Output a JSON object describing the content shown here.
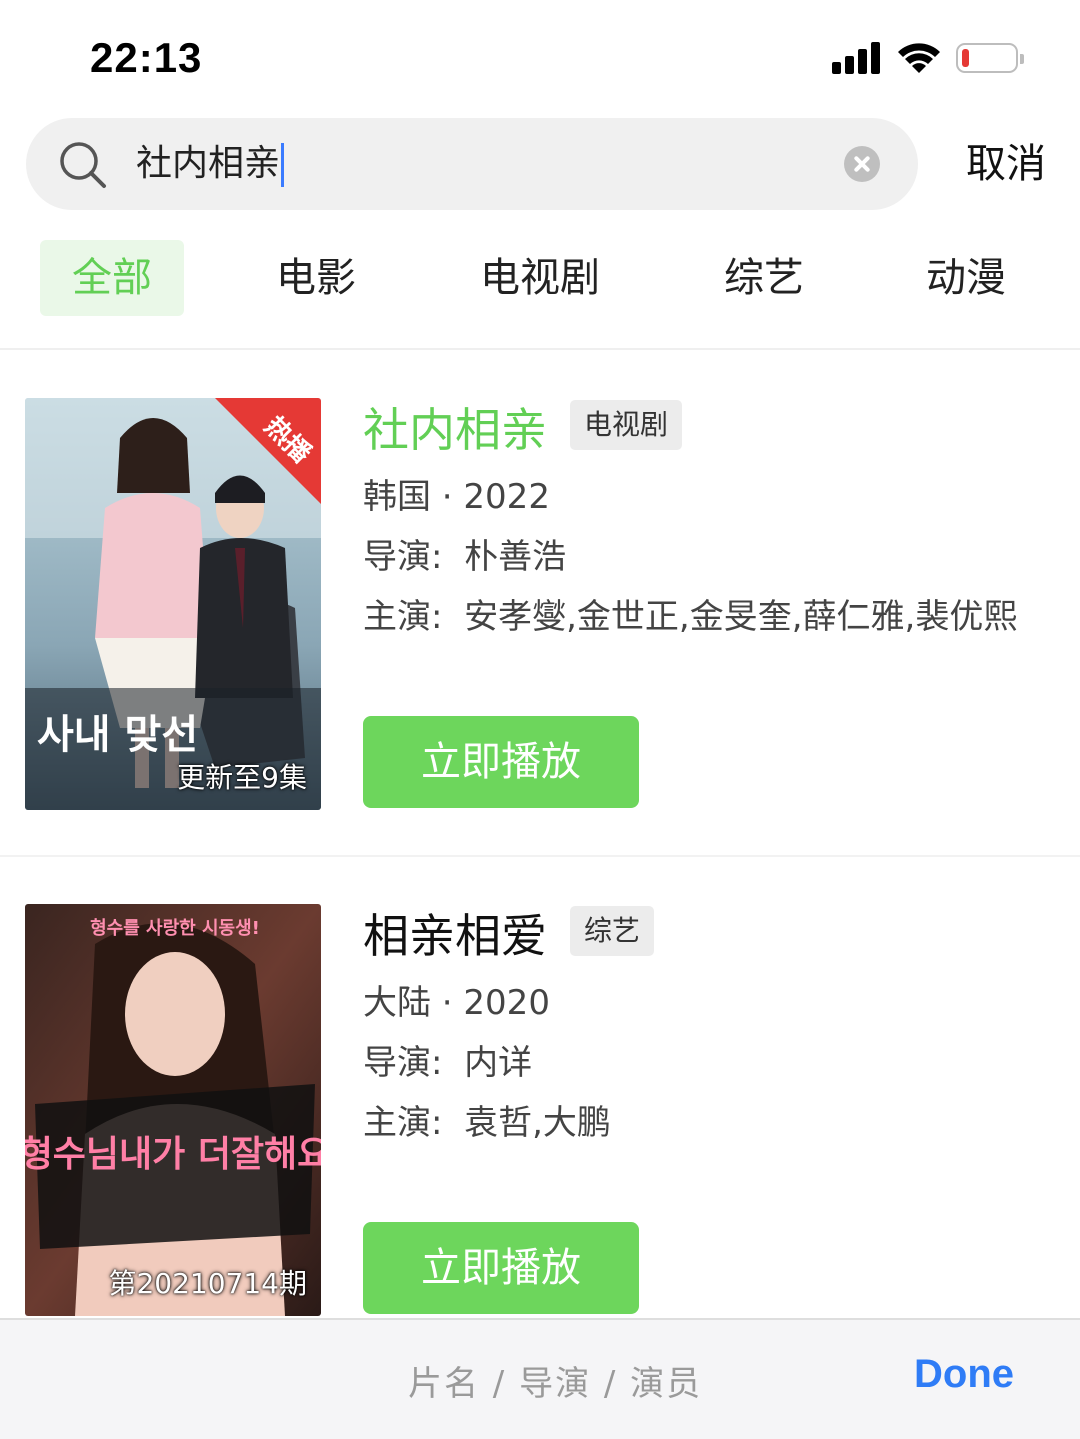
{
  "status_bar": {
    "time": "22:13"
  },
  "search": {
    "query": "社内相亲",
    "cancel_label": "取消"
  },
  "tabs": [
    {
      "label": "全部",
      "active": true
    },
    {
      "label": "电影",
      "active": false
    },
    {
      "label": "电视剧",
      "active": false
    },
    {
      "label": "综艺",
      "active": false
    },
    {
      "label": "动漫",
      "active": false
    }
  ],
  "results": [
    {
      "title": "社内相亲",
      "tag": "电视剧",
      "region_year": "韩国 · 2022",
      "director_label": "导演:",
      "director": "朴善浩",
      "cast_label": "主演:",
      "cast": "安孝燮,金世正,金旻奎,薛仁雅,裴优熙",
      "play_label": "立即播放",
      "poster_badge": "热播",
      "poster_caption": "更新至9集",
      "poster_title_text": "사내 맞선"
    },
    {
      "title": "相亲相爱",
      "tag": "综艺",
      "region_year": "大陆 · 2020",
      "director_label": "导演:",
      "director": "内详",
      "cast_label": "主演:",
      "cast": "袁哲,大鹏",
      "play_label": "立即播放",
      "poster_caption": "第20210714期",
      "poster_title_text": "형수님내가 더잘해요",
      "poster_subtitle_text": "형수를 사랑한 시동생!"
    }
  ],
  "accessory": {
    "hint": "片名 / 导演 / 演员",
    "done_label": "Done"
  },
  "colors": {
    "accent_green": "#62cf55",
    "play_green": "#6dd65c",
    "done_blue": "#2f7cf6"
  }
}
